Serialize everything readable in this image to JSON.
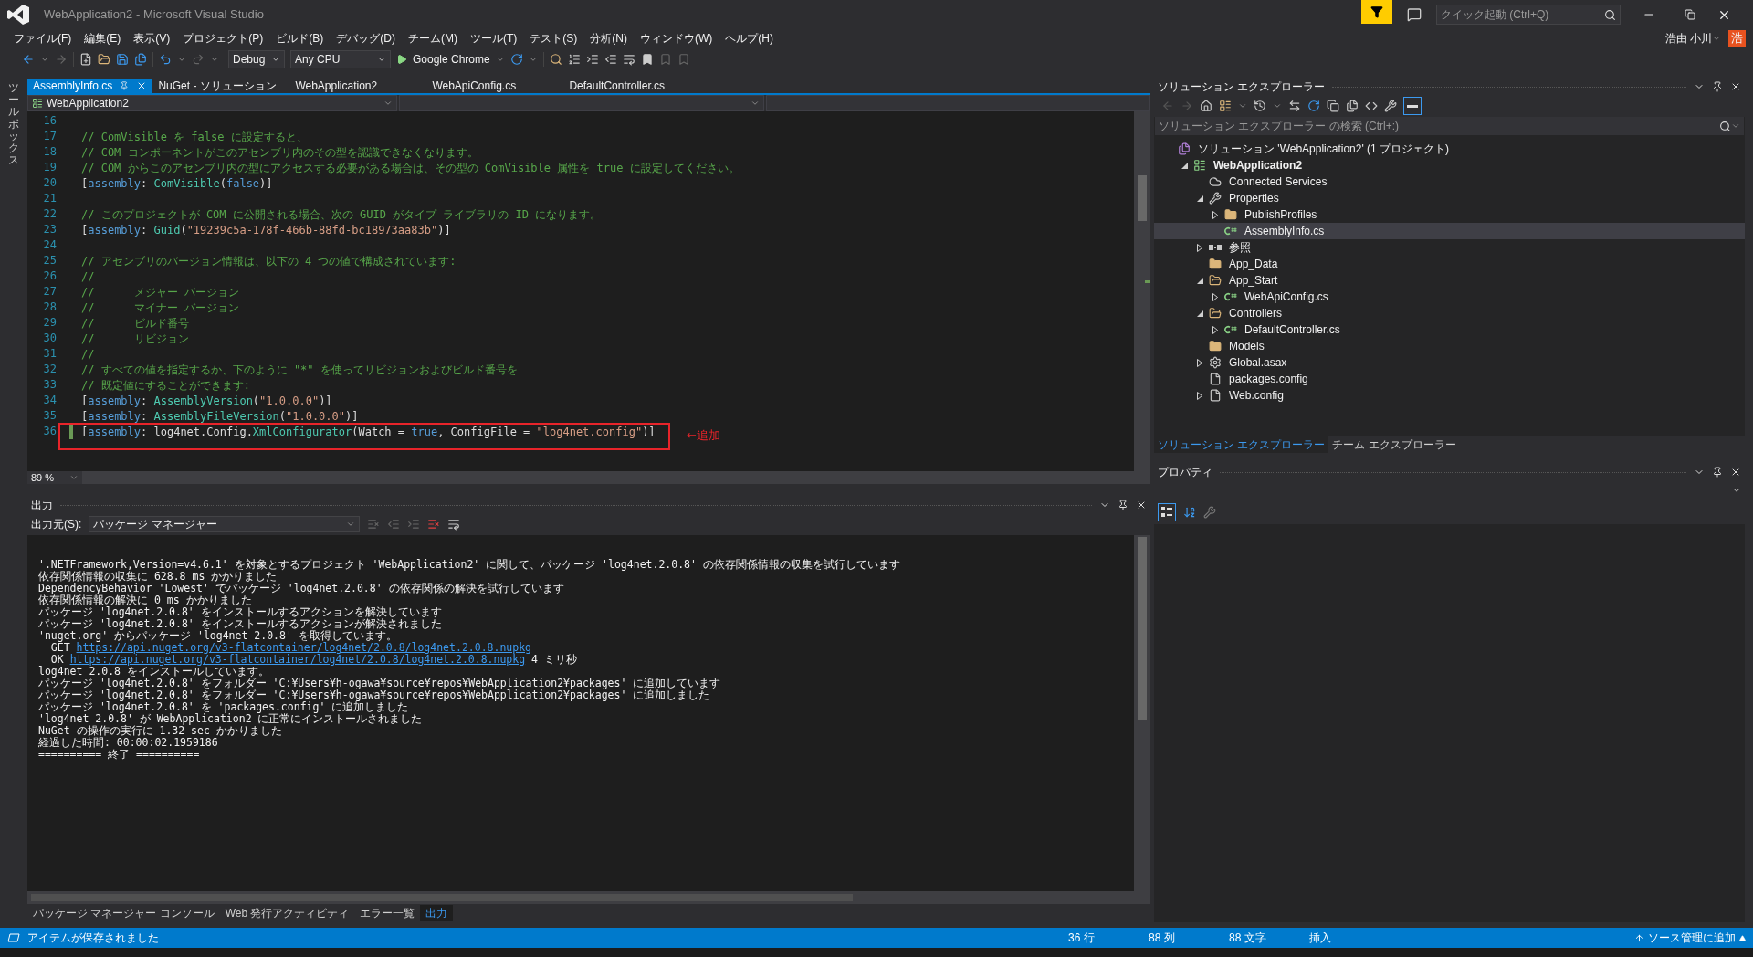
{
  "window": {
    "title": "WebApplication2 - Microsoft Visual Studio",
    "quick_launch": {
      "placeholder": "クイック起動 (Ctrl+Q)"
    },
    "user": {
      "name": "浩由 小川",
      "initial": "浩"
    }
  },
  "menu": [
    "ファイル(F)",
    "編集(E)",
    "表示(V)",
    "プロジェクト(P)",
    "ビルド(B)",
    "デバッグ(D)",
    "チーム(M)",
    "ツール(T)",
    "テスト(S)",
    "分析(N)",
    "ウィンドウ(W)",
    "ヘルプ(H)"
  ],
  "toolbar": {
    "configuration": "Debug",
    "platform": "Any CPU",
    "run_target": "Google Chrome"
  },
  "toolbox": {
    "label": "ツールボックス"
  },
  "editor": {
    "tabs": [
      {
        "label": "AssemblyInfo.cs",
        "selected": true
      },
      {
        "label": "NuGet - ソリューション",
        "selected": false
      },
      {
        "label": "WebApplication2",
        "selected": false
      },
      {
        "label": "WebApiConfig.cs",
        "selected": false
      },
      {
        "label": "DefaultController.cs",
        "selected": false
      }
    ],
    "project_dropdown": "WebApplication2",
    "zoom": "89 %",
    "lines": [
      {
        "number": "16",
        "changed": false
      },
      {
        "number": "17",
        "changed": false,
        "segments": [
          {
            "kind": "comment",
            "text": "// ComVisible を false に設定すると、"
          }
        ]
      },
      {
        "number": "18",
        "changed": false,
        "segments": [
          {
            "kind": "comment",
            "text": "// COM コンポーネントがこのアセンブリ内のその型を認識できなくなります。"
          }
        ]
      },
      {
        "number": "19",
        "changed": false,
        "segments": [
          {
            "kind": "comment",
            "text": "// COM からこのアセンブリ内の型にアクセスする必要がある場合は、その型の ComVisible 属性を true に設定してください。"
          }
        ]
      },
      {
        "number": "20",
        "changed": false,
        "segments": [
          {
            "kind": "plain",
            "text": "["
          },
          {
            "kind": "keyword",
            "text": "assembly"
          },
          {
            "kind": "plain",
            "text": ": "
          },
          {
            "kind": "type",
            "text": "ComVisible"
          },
          {
            "kind": "plain",
            "text": "("
          },
          {
            "kind": "keyword",
            "text": "false"
          },
          {
            "kind": "plain",
            "text": ")]"
          }
        ]
      },
      {
        "number": "21",
        "changed": false
      },
      {
        "number": "22",
        "changed": false,
        "segments": [
          {
            "kind": "comment",
            "text": "// このプロジェクトが COM に公開される場合、次の GUID がタイプ ライブラリの ID になります。"
          }
        ]
      },
      {
        "number": "23",
        "changed": false,
        "segments": [
          {
            "kind": "plain",
            "text": "["
          },
          {
            "kind": "keyword",
            "text": "assembly"
          },
          {
            "kind": "plain",
            "text": ": "
          },
          {
            "kind": "type",
            "text": "Guid"
          },
          {
            "kind": "plain",
            "text": "("
          },
          {
            "kind": "string",
            "text": "\"19239c5a-178f-466b-88fd-bc18973aa83b\""
          },
          {
            "kind": "plain",
            "text": ")]"
          }
        ]
      },
      {
        "number": "24",
        "changed": false
      },
      {
        "number": "25",
        "changed": false,
        "segments": [
          {
            "kind": "comment",
            "text": "// アセンブリのバージョン情報は、以下の 4 つの値で構成されています:"
          }
        ]
      },
      {
        "number": "26",
        "changed": false,
        "segments": [
          {
            "kind": "comment",
            "text": "//"
          }
        ]
      },
      {
        "number": "27",
        "changed": false,
        "segments": [
          {
            "kind": "comment",
            "text": "//      メジャー バージョン"
          }
        ]
      },
      {
        "number": "28",
        "changed": false,
        "segments": [
          {
            "kind": "comment",
            "text": "//      マイナー バージョン"
          }
        ]
      },
      {
        "number": "29",
        "changed": false,
        "segments": [
          {
            "kind": "comment",
            "text": "//      ビルド番号"
          }
        ]
      },
      {
        "number": "30",
        "changed": false,
        "segments": [
          {
            "kind": "comment",
            "text": "//      リビジョン"
          }
        ]
      },
      {
        "number": "31",
        "changed": false,
        "segments": [
          {
            "kind": "comment",
            "text": "//"
          }
        ]
      },
      {
        "number": "32",
        "changed": false,
        "segments": [
          {
            "kind": "comment",
            "text": "// すべての値を指定するか、下のように \"*\" を使ってリビジョンおよびビルド番号を"
          }
        ]
      },
      {
        "number": "33",
        "changed": false,
        "segments": [
          {
            "kind": "comment",
            "text": "// 既定値にすることができます:"
          }
        ]
      },
      {
        "number": "34",
        "changed": false,
        "segments": [
          {
            "kind": "plain",
            "text": "["
          },
          {
            "kind": "keyword",
            "text": "assembly"
          },
          {
            "kind": "plain",
            "text": ": "
          },
          {
            "kind": "type",
            "text": "AssemblyVersion"
          },
          {
            "kind": "plain",
            "text": "("
          },
          {
            "kind": "string",
            "text": "\"1.0.0.0\""
          },
          {
            "kind": "plain",
            "text": ")]"
          }
        ]
      },
      {
        "number": "35",
        "changed": false,
        "segments": [
          {
            "kind": "plain",
            "text": "["
          },
          {
            "kind": "keyword",
            "text": "assembly"
          },
          {
            "kind": "plain",
            "text": ": "
          },
          {
            "kind": "type",
            "text": "AssemblyFileVersion"
          },
          {
            "kind": "plain",
            "text": "("
          },
          {
            "kind": "string",
            "text": "\"1.0.0.0\""
          },
          {
            "kind": "plain",
            "text": ")]"
          }
        ]
      },
      {
        "number": "36",
        "changed": true,
        "segments": [
          {
            "kind": "plain",
            "text": "["
          },
          {
            "kind": "keyword",
            "text": "assembly"
          },
          {
            "kind": "plain",
            "text": ": log4net.Config."
          },
          {
            "kind": "type",
            "text": "XmlConfigurator"
          },
          {
            "kind": "plain",
            "text": "(Watch = "
          },
          {
            "kind": "keyword",
            "text": "true"
          },
          {
            "kind": "plain",
            "text": ", ConfigFile = "
          },
          {
            "kind": "string",
            "text": "\"log4net.config\""
          },
          {
            "kind": "plain",
            "text": ")]"
          }
        ]
      }
    ],
    "annotation": {
      "text": "←追加"
    }
  },
  "output": {
    "title": "出力",
    "source_label": "出力元(S):",
    "source": "パッケージ マネージャー",
    "lines": [
      {
        "kind": "text",
        "text": "'.NETFramework,Version=v4.6.1' を対象とするプロジェクト 'WebApplication2' に関して、パッケージ 'log4net.2.0.8' の依存関係情報の収集を試行しています"
      },
      {
        "kind": "text",
        "text": "依存関係情報の収集に 628.8 ms かかりました"
      },
      {
        "kind": "text",
        "text": "DependencyBehavior 'Lowest' でパッケージ 'log4net.2.0.8' の依存関係の解決を試行しています"
      },
      {
        "kind": "text",
        "text": "依存関係情報の解決に 0 ms かかりました"
      },
      {
        "kind": "text",
        "text": "パッケージ 'log4net.2.0.8' をインストールするアクションを解決しています"
      },
      {
        "kind": "text",
        "text": "パッケージ 'log4net.2.0.8' をインストールするアクションが解決されました"
      },
      {
        "kind": "text",
        "text": "'nuget.org' からパッケージ 'log4net 2.0.8' を取得しています。"
      },
      {
        "kind": "link",
        "prefix": "  GET ",
        "url": "https://api.nuget.org/v3-flatcontainer/log4net/2.0.8/log4net.2.0.8.nupkg"
      },
      {
        "kind": "link",
        "prefix": "  OK ",
        "url": "https://api.nuget.org/v3-flatcontainer/log4net/2.0.8/log4net.2.0.8.nupkg",
        "suffix": " 4 ミリ秒"
      },
      {
        "kind": "text",
        "text": "log4net 2.0.8 をインストールしています。"
      },
      {
        "kind": "text",
        "text": "パッケージ 'log4net.2.0.8' をフォルダー 'C:¥Users¥h-ogawa¥source¥repos¥WebApplication2¥packages' に追加しています"
      },
      {
        "kind": "text",
        "text": "パッケージ 'log4net.2.0.8' をフォルダー 'C:¥Users¥h-ogawa¥source¥repos¥WebApplication2¥packages' に追加しました"
      },
      {
        "kind": "text",
        "text": "パッケージ 'log4net.2.0.8' を 'packages.config' に追加しました"
      },
      {
        "kind": "text",
        "text": "'log4net 2.0.8' が WebApplication2 に正常にインストールされました"
      },
      {
        "kind": "text",
        "text": "NuGet の操作の実行に 1.32 sec かかりました"
      },
      {
        "kind": "text",
        "text": "経過した時間: 00:00:02.1959186"
      },
      {
        "kind": "text",
        "text": "========== 終了 =========="
      }
    ]
  },
  "bottom_tabs": [
    {
      "label": "パッケージ マネージャー コンソール",
      "selected": false
    },
    {
      "label": "Web 発行アクティビティ",
      "selected": false
    },
    {
      "label": "エラー一覧",
      "selected": false
    },
    {
      "label": "出力",
      "selected": true
    }
  ],
  "solution_explorer": {
    "title": "ソリューション エクスプローラー",
    "search": {
      "placeholder": "ソリューション エクスプローラー の検索 (Ctrl+:)"
    },
    "tree": [
      {
        "label": "ソリューション 'WebApplication2' (1 プロジェクト)",
        "kind": "solution",
        "selected": false,
        "children": [
          {
            "label": "WebApplication2",
            "kind": "project",
            "expanded": true,
            "selected": false,
            "children": [
              {
                "label": "Connected Services",
                "kind": "cloud",
                "selected": false
              },
              {
                "label": "Properties",
                "kind": "wrench",
                "expanded": true,
                "selected": false,
                "children": [
                  {
                    "label": "PublishProfiles",
                    "kind": "folder",
                    "expanded": false,
                    "selected": false
                  },
                  {
                    "label": "AssemblyInfo.cs",
                    "kind": "cs",
                    "selected": true
                  }
                ]
              },
              {
                "label": "参照",
                "kind": "refs",
                "expanded": false,
                "selected": false
              },
              {
                "label": "App_Data",
                "kind": "folder",
                "selected": false
              },
              {
                "label": "App_Start",
                "kind": "folder-open",
                "expanded": true,
                "selected": false,
                "children": [
                  {
                    "label": "WebApiConfig.cs",
                    "kind": "cs",
                    "expanded": false,
                    "selected": false
                  }
                ]
              },
              {
                "label": "Controllers",
                "kind": "folder-open",
                "expanded": true,
                "selected": false,
                "children": [
                  {
                    "label": "DefaultController.cs",
                    "kind": "cs",
                    "expanded": false,
                    "selected": false
                  }
                ]
              },
              {
                "label": "Models",
                "kind": "folder",
                "selected": false
              },
              {
                "label": "Global.asax",
                "kind": "asax",
                "expanded": false,
                "selected": false
              },
              {
                "label": "packages.config",
                "kind": "config",
                "selected": false
              },
              {
                "label": "Web.config",
                "kind": "config",
                "expanded": false,
                "selected": false
              }
            ]
          }
        ]
      }
    ],
    "tabs": [
      {
        "label": "ソリューション エクスプローラー",
        "selected": true
      },
      {
        "label": "チーム エクスプローラー",
        "selected": false
      }
    ]
  },
  "properties": {
    "title": "プロパティ"
  },
  "status_bar": {
    "message": "アイテムが保存されました",
    "line": "36 行",
    "column": "88 列",
    "char": "88 文字",
    "mode": "挿入",
    "source_control": "ソース管理に追加"
  }
}
